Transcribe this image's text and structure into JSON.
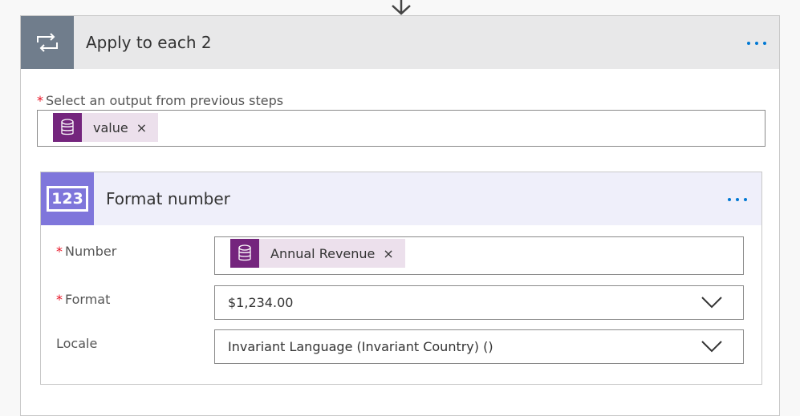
{
  "outer": {
    "title": "Apply to each 2",
    "select_label": "Select an output from previous steps",
    "select_required": "*",
    "token": {
      "label": "value",
      "close": "×"
    }
  },
  "inner": {
    "title": "Format number",
    "badge": "123",
    "number": {
      "label": "Number",
      "required": "*",
      "token": {
        "label": "Annual Revenue",
        "close": "×"
      }
    },
    "format": {
      "label": "Format",
      "required": "*",
      "value": "$1,234.00"
    },
    "locale": {
      "label": "Locale",
      "value": "Invariant Language (Invariant Country) ()"
    }
  },
  "colors": {
    "outer_icon_bg": "#707d8c",
    "inner_icon_bg": "#7f76db",
    "token_icon_bg": "#74257d",
    "token_bg": "#ece0ec",
    "accent": "#0078d4",
    "required": "#e81123"
  },
  "icons": {
    "outer": "loop-icon",
    "inner": "number-format-icon",
    "token": "database-icon",
    "more": "more-options-icon",
    "dropdown": "chevron-down-icon",
    "connector": "arrow-down-icon"
  }
}
